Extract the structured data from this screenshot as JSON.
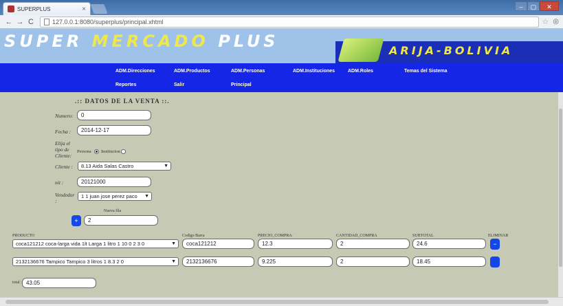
{
  "browser": {
    "tab_title": "SUPERPLUS",
    "tab_close": "×",
    "url": "127.0.0.1:8080/superplus/principal.xhtml",
    "back": "←",
    "forward": "→",
    "reload": "C",
    "star": "☆",
    "menu": "◎",
    "minimize": "–",
    "maximize": "▢",
    "close": "✕"
  },
  "banner": {
    "logo_word1": "SUPER",
    "logo_word2": "MERCADO",
    "logo_word3": "PLUS",
    "logo_sub": "ARIJA-BOLIVIA",
    "colors": {
      "banner_bg": "#9fc2e8",
      "navbar_bg": "#1526e6",
      "accent_yellow": "#f0e84a"
    }
  },
  "nav": {
    "items_row1": [
      "ADM.Direcciones",
      "ADM.Productos",
      "ADM.Personas",
      "ADM.Instituciones",
      "ADM.Roles",
      "Temas del Sistema"
    ],
    "items_row2": [
      "Reportes",
      "Salir",
      "Principal"
    ]
  },
  "form": {
    "section_title": ".:: DATOS DE LA VENTA ::.",
    "numero_label": "Numero:",
    "numero_value": "0",
    "fecha_label": "Fecha :",
    "fecha_value": "2014-12-17",
    "tipo_label": "Elija el tipo de Cliente:",
    "radio_persona": "Persona",
    "radio_institucion": "Institucion",
    "cliente_label": "Cliente :",
    "cliente_value": "8.13 Aida Salas Castro",
    "nit_label": "nit :",
    "nit_value": "20121000",
    "vendedor_label": "Vendedor :",
    "vendedor_value": "1 1 juan jose perez paco",
    "nueva_fila_label": "Nueva fila",
    "add_btn": "+",
    "filas_value": "2"
  },
  "table": {
    "headers": [
      "PRODUCTO",
      "Codigo Barra",
      "PRECIO_COMPRA",
      "CANTIDAD_COMPRA",
      "SUBTOTAL",
      "ELIMINAR"
    ],
    "rows": [
      {
        "producto": "coca121212 coca-larga vida 1lt Larga 1 litro 1 10 0 2 3 0",
        "codigo": "coca121212",
        "precio": "12.3",
        "cantidad": "2",
        "subtotal": "24.6",
        "delete": "−"
      },
      {
        "producto": "2132136676 Tampico Tampico 3 litros 1 8.3 2 0",
        "codigo": "2132136676",
        "precio": "9.225",
        "cantidad": "2",
        "subtotal": "18.45",
        "delete": ""
      }
    ],
    "total_label": "total :",
    "total_value": "43.05"
  }
}
